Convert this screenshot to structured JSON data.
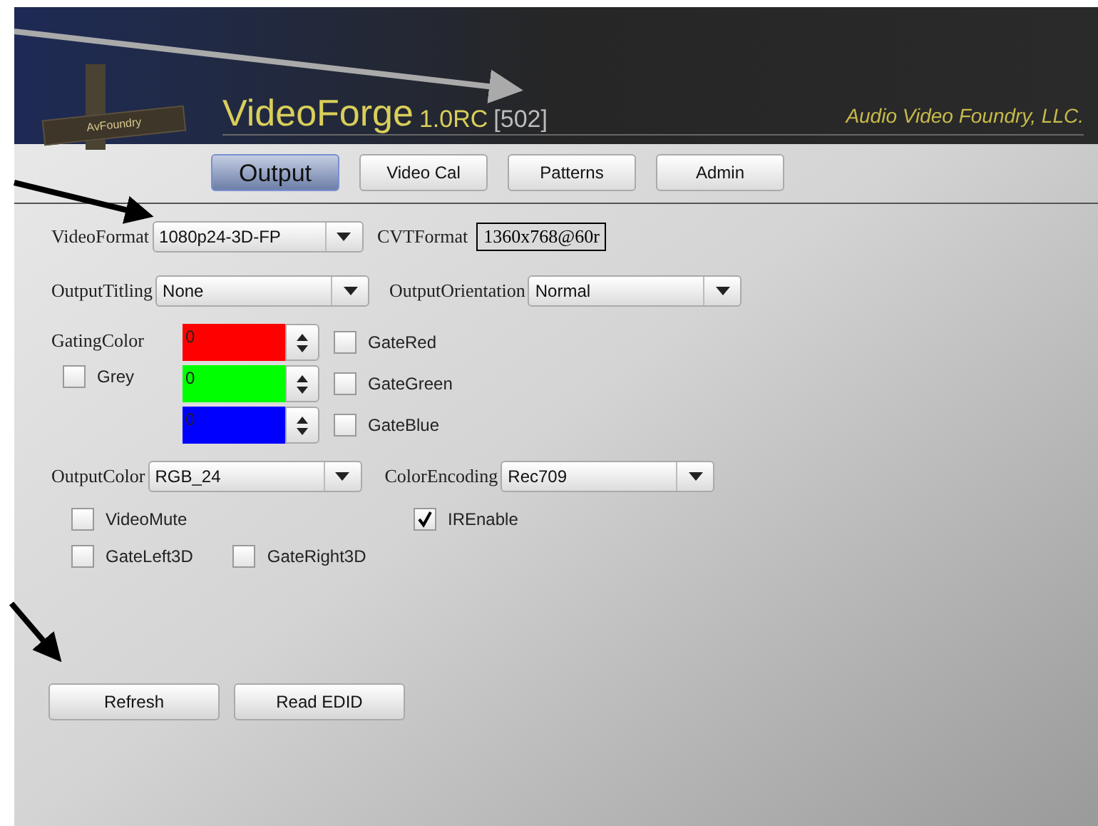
{
  "header": {
    "logo": "AvFoundry",
    "app_name": "VideoForge",
    "version": "1.0RC",
    "build": "[502]",
    "company": "Audio Video Foundry, LLC."
  },
  "tabs": [
    {
      "label": "Output",
      "selected": true
    },
    {
      "label": "Video Cal",
      "selected": false
    },
    {
      "label": "Patterns",
      "selected": false
    },
    {
      "label": "Admin",
      "selected": false
    }
  ],
  "video_format": {
    "label": "VideoFormat",
    "value": "1080p24-3D-FP"
  },
  "cvt_format": {
    "label": "CVTFormat",
    "value": "1360x768@60r"
  },
  "output_titling": {
    "label": "OutputTitling",
    "value": "None"
  },
  "output_orientation": {
    "label": "OutputOrientation",
    "value": "Normal"
  },
  "gating": {
    "label": "GatingColor",
    "grey": {
      "label": "Grey",
      "checked": false
    },
    "channels": [
      {
        "value": "0",
        "color": "#ff0000",
        "gate_label": "GateRed",
        "checked": false
      },
      {
        "value": "0",
        "color": "#00ff00",
        "gate_label": "GateGreen",
        "checked": false
      },
      {
        "value": "0",
        "color": "#0000ff",
        "gate_label": "GateBlue",
        "checked": false
      }
    ]
  },
  "output_color": {
    "label": "OutputColor",
    "value": "RGB_24"
  },
  "color_encoding": {
    "label": "ColorEncoding",
    "value": "Rec709"
  },
  "video_mute": {
    "label": "VideoMute",
    "checked": false
  },
  "ir_enable": {
    "label": "IREnable",
    "checked": true
  },
  "gate_left_3d": {
    "label": "GateLeft3D",
    "checked": false
  },
  "gate_right_3d": {
    "label": "GateRight3D",
    "checked": false
  },
  "buttons": [
    "Refresh",
    "Read EDID"
  ]
}
